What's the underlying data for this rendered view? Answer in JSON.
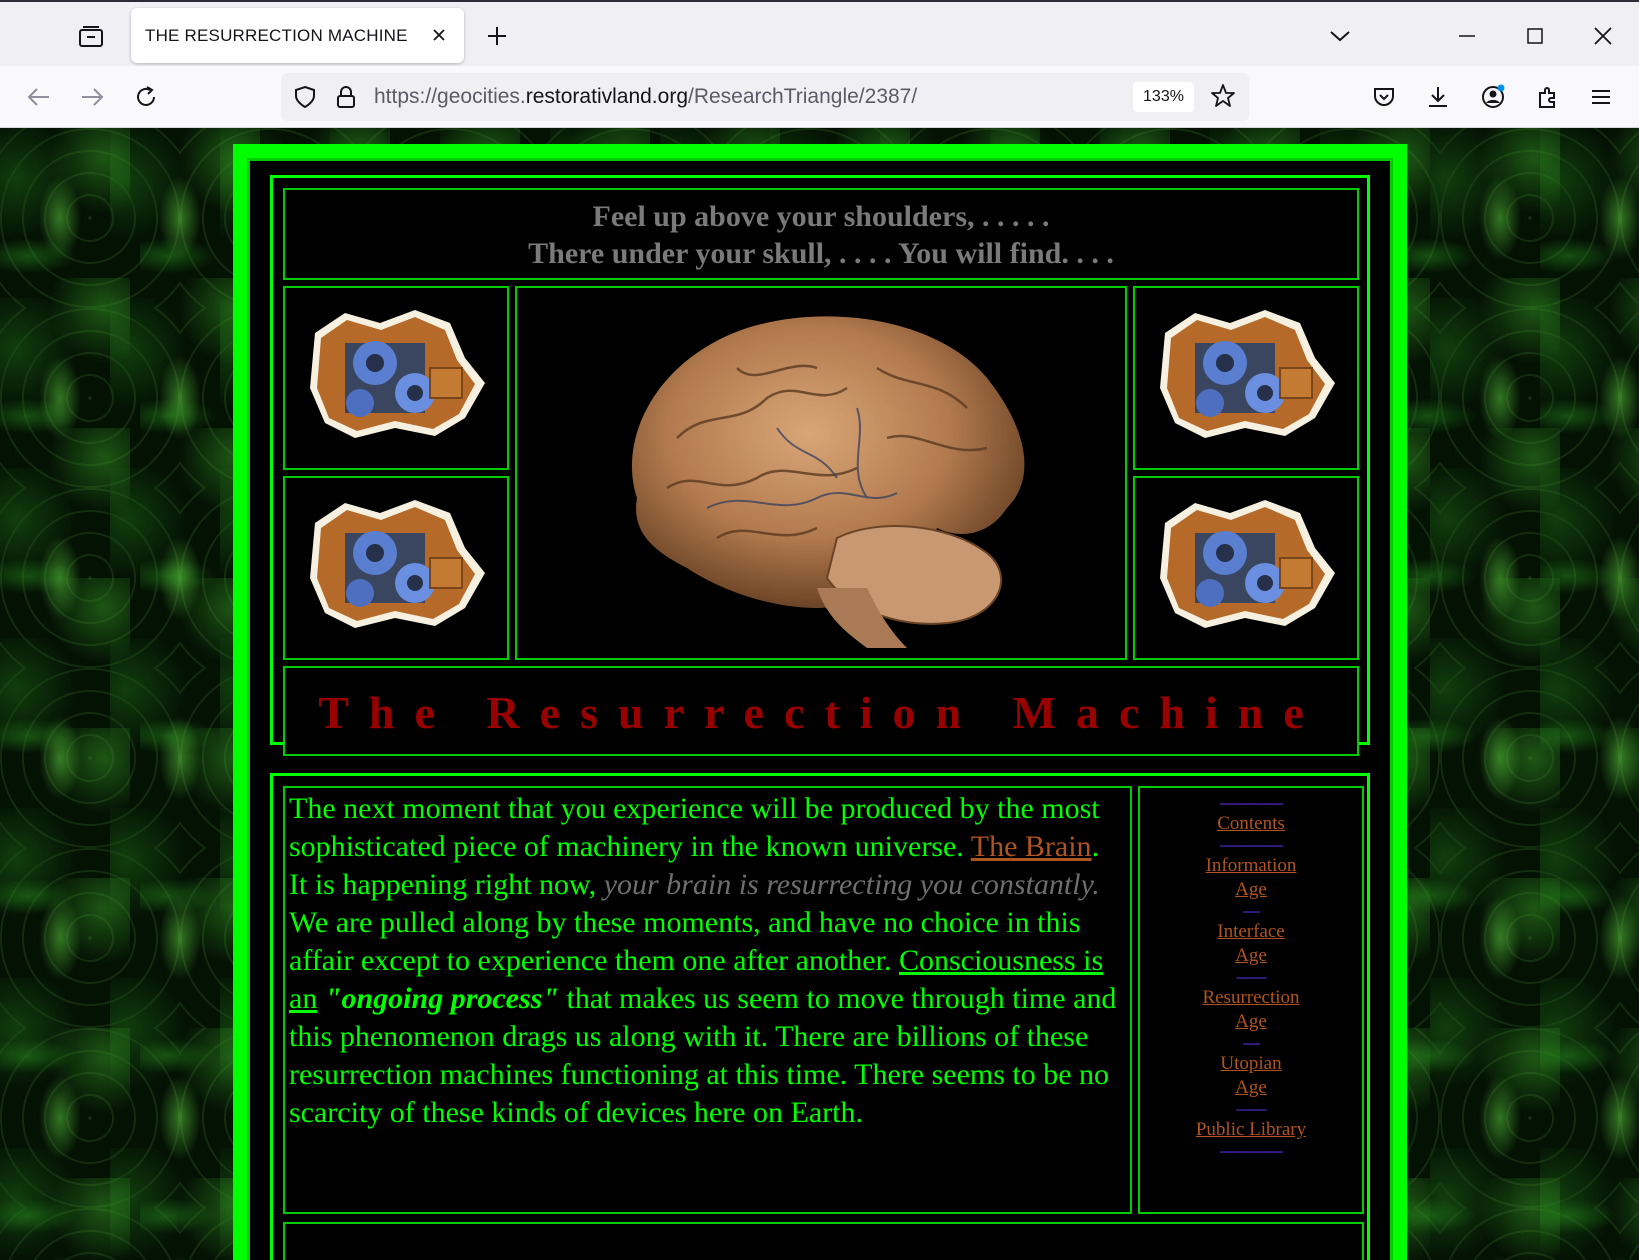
{
  "browser": {
    "tab_title": "THE RESURRECTION MACHINE",
    "url_prefix": "https://geocities.",
    "url_domain": "restorativland.org",
    "url_path": "/ResearchTriangle/2387/",
    "zoom": "133%"
  },
  "page": {
    "tagline_line1": "Feel up above your shoulders, . . . . .",
    "tagline_line2": "There under your skull, . . . . You will find. . . .",
    "title": "The Resurrection Machine",
    "body": {
      "p1_text": "The next moment that you experience will be produced by the most sophisticated piece of machinery in the known universe. ",
      "p1_link": "The Brain",
      "p1_end": ".",
      "p2_start": "It is happening right now, ",
      "p2_faded": "your brain is resurrecting you constantly.",
      "p2_rest": " We are pulled along by these moments, and have no choice in this affair except to experience them one after another. ",
      "p2_link": "Consciousness is an",
      "p2_bold": "\"ongoing process\"",
      "p2_end": " that makes us seem to move through time and this phenomenon drags us along with it. There are billions of these resurrection machines functioning at this time. There seems to be no scarcity of these kinds of devices here on Earth."
    },
    "nav": {
      "sep_long": "-------------------",
      "sep_short": "-----",
      "sep_mid": "---------",
      "contents": "Contents",
      "info_1": "Information",
      "info_2": "Age",
      "interface_1": "Interface",
      "interface_2": "Age",
      "resurrection_1": "Resurrection",
      "resurrection_2": "Age",
      "utopian_1": "Utopian",
      "utopian_2": "Age",
      "library": "Public Library"
    }
  },
  "colors": {
    "frame_green": "#00ff00",
    "title_red": "#990000",
    "link_brown": "#b0541f",
    "separator_purple": "#6a33ff"
  }
}
